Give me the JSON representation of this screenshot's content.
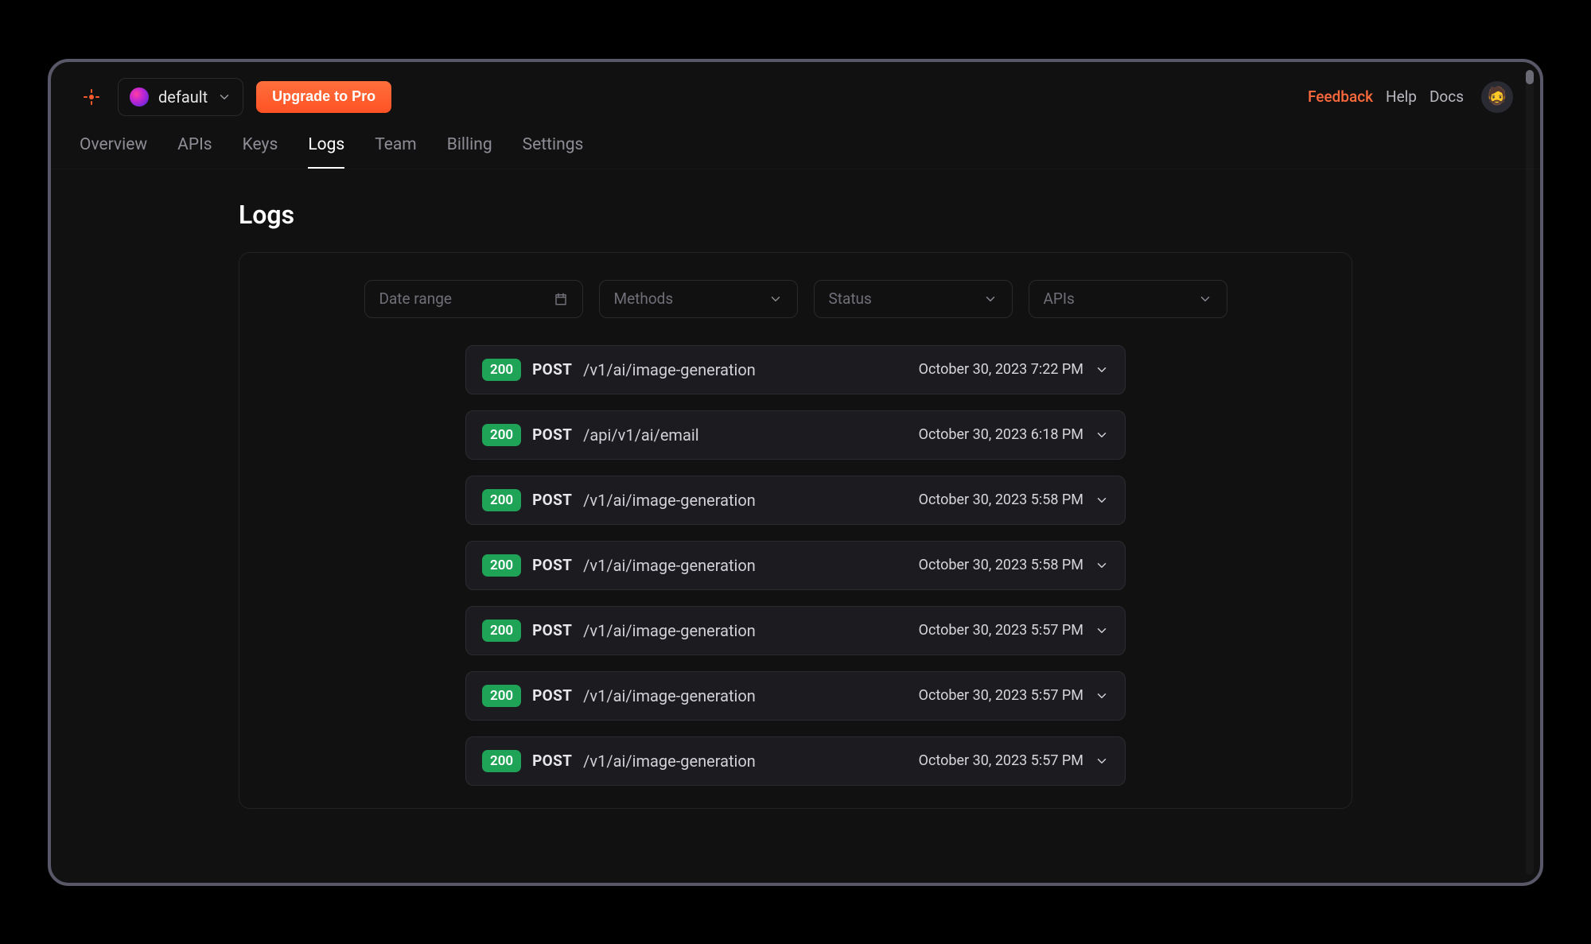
{
  "header": {
    "workspace_name": "default",
    "upgrade_label": "Upgrade to Pro",
    "links": {
      "feedback": "Feedback",
      "help": "Help",
      "docs": "Docs"
    },
    "user_emoji": "🧔"
  },
  "tabs": [
    {
      "id": "overview",
      "label": "Overview",
      "active": false
    },
    {
      "id": "apis",
      "label": "APIs",
      "active": false
    },
    {
      "id": "keys",
      "label": "Keys",
      "active": false
    },
    {
      "id": "logs",
      "label": "Logs",
      "active": true
    },
    {
      "id": "team",
      "label": "Team",
      "active": false
    },
    {
      "id": "billing",
      "label": "Billing",
      "active": false
    },
    {
      "id": "settings",
      "label": "Settings",
      "active": false
    }
  ],
  "page": {
    "title": "Logs"
  },
  "filters": {
    "date_placeholder": "Date range",
    "methods_placeholder": "Methods",
    "status_placeholder": "Status",
    "apis_placeholder": "APIs"
  },
  "logs": [
    {
      "status": "200",
      "method": "POST",
      "path": "/v1/ai/image-generation",
      "timestamp": "October 30, 2023 7:22 PM"
    },
    {
      "status": "200",
      "method": "POST",
      "path": "/api/v1/ai/email",
      "timestamp": "October 30, 2023 6:18 PM"
    },
    {
      "status": "200",
      "method": "POST",
      "path": "/v1/ai/image-generation",
      "timestamp": "October 30, 2023 5:58 PM"
    },
    {
      "status": "200",
      "method": "POST",
      "path": "/v1/ai/image-generation",
      "timestamp": "October 30, 2023 5:58 PM"
    },
    {
      "status": "200",
      "method": "POST",
      "path": "/v1/ai/image-generation",
      "timestamp": "October 30, 2023 5:57 PM"
    },
    {
      "status": "200",
      "method": "POST",
      "path": "/v1/ai/image-generation",
      "timestamp": "October 30, 2023 5:57 PM"
    },
    {
      "status": "200",
      "method": "POST",
      "path": "/v1/ai/image-generation",
      "timestamp": "October 30, 2023 5:57 PM"
    }
  ],
  "colors": {
    "accent": "#ff5a2b",
    "badge_ok": "#1fa356"
  }
}
